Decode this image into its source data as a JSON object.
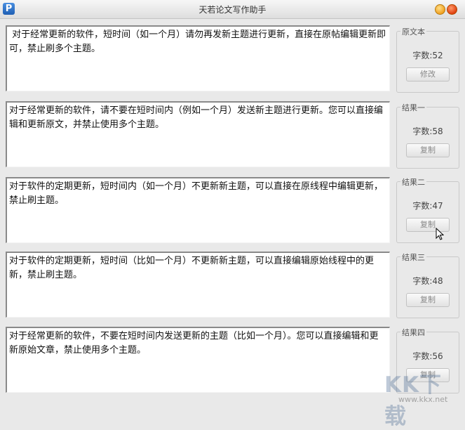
{
  "window": {
    "title": "天若论文写作助手",
    "icon_letter": "P"
  },
  "panels": [
    {
      "text": " 对于经常更新的软件，短时间（如一个月）请勿再发新主题进行更新，直接在原帖编辑更新即可，禁止刷多个主题。",
      "group_label": "原文本",
      "count": "字数:52",
      "button": "修改"
    },
    {
      "text": "对于经常更新的软件，请不要在短时间内（例如一个月）发送新主题进行更新。您可以直接编辑和更新原文，并禁止使用多个主题。",
      "group_label": "结果一",
      "count": "字数:58",
      "button": "复制"
    },
    {
      "text": "对于软件的定期更新，短时间内（如一个月）不更新新主题，可以直接在原线程中编辑更新，禁止刷主题。",
      "group_label": "结果二",
      "count": "字数:47",
      "button": "复制"
    },
    {
      "text": "对于软件的定期更新，短时间（比如一个月）不更新新主题，可以直接编辑原始线程中的更新，禁止刷主题。",
      "group_label": "结果三",
      "count": "字数:48",
      "button": "复制"
    },
    {
      "text": "对于经常更新的软件，不要在短时间内发送更新的主题（比如一个月）。您可以直接编辑和更新原始文章，禁止使用多个主题。",
      "group_label": "结果四",
      "count": "字数:56",
      "button": "复制"
    }
  ],
  "watermark": {
    "logo": "KK下载",
    "url": "www.kkx.net"
  }
}
